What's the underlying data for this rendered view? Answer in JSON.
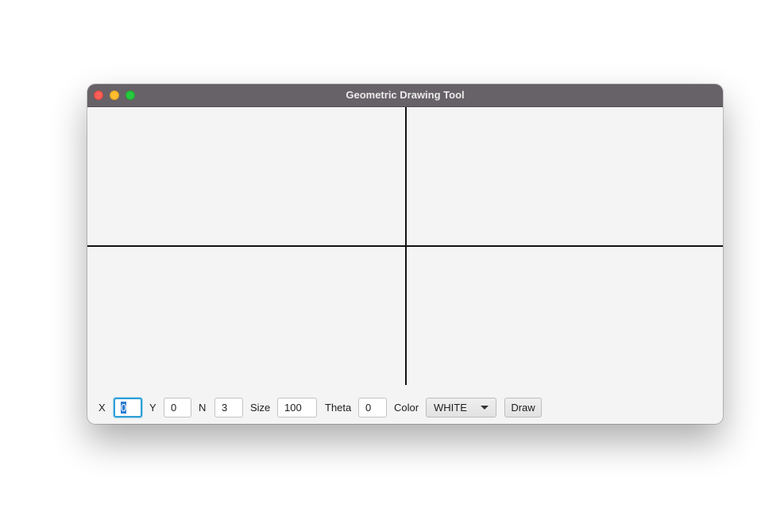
{
  "window": {
    "title": "Geometric Drawing Tool"
  },
  "controls": {
    "x_label": "X",
    "x_value": "0",
    "y_label": "Y",
    "y_value": "0",
    "n_label": "N",
    "n_value": "3",
    "size_label": "Size",
    "size_value": "100",
    "theta_label": "Theta",
    "theta_value": "0",
    "color_label": "Color",
    "color_value": "WHITE",
    "draw_label": "Draw"
  },
  "colors": {
    "titlebar": "#676267",
    "canvas": "#f4f4f4",
    "focus_ring": "#2d9fd6"
  }
}
